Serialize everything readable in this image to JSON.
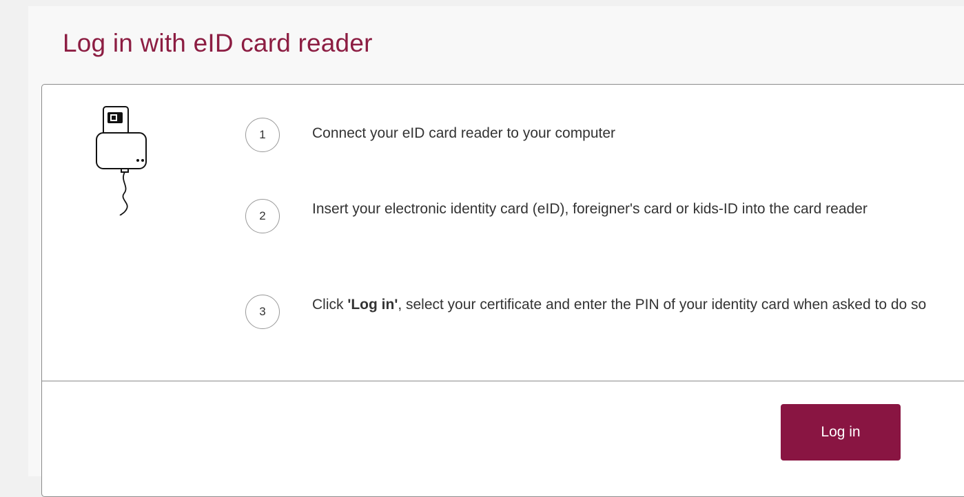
{
  "page": {
    "title": "Log in with eID card reader"
  },
  "steps": [
    {
      "number": "1",
      "text": "Connect your eID card reader to your computer"
    },
    {
      "number": "2",
      "text": "Insert your electronic identity card (eID), foreigner's card or kids-ID into the card reader"
    },
    {
      "number": "3",
      "text_before": "Click ",
      "text_bold": "'Log in'",
      "text_after": ", select your certificate and enter the PIN of your identity card when asked to do so"
    }
  ],
  "actions": {
    "login_label": "Log in"
  },
  "colors": {
    "brand": "#8c1d42",
    "button_bg": "#891542",
    "text": "#333333",
    "border": "#8a8a8a"
  },
  "icons": {
    "reader": "card-reader-icon"
  }
}
